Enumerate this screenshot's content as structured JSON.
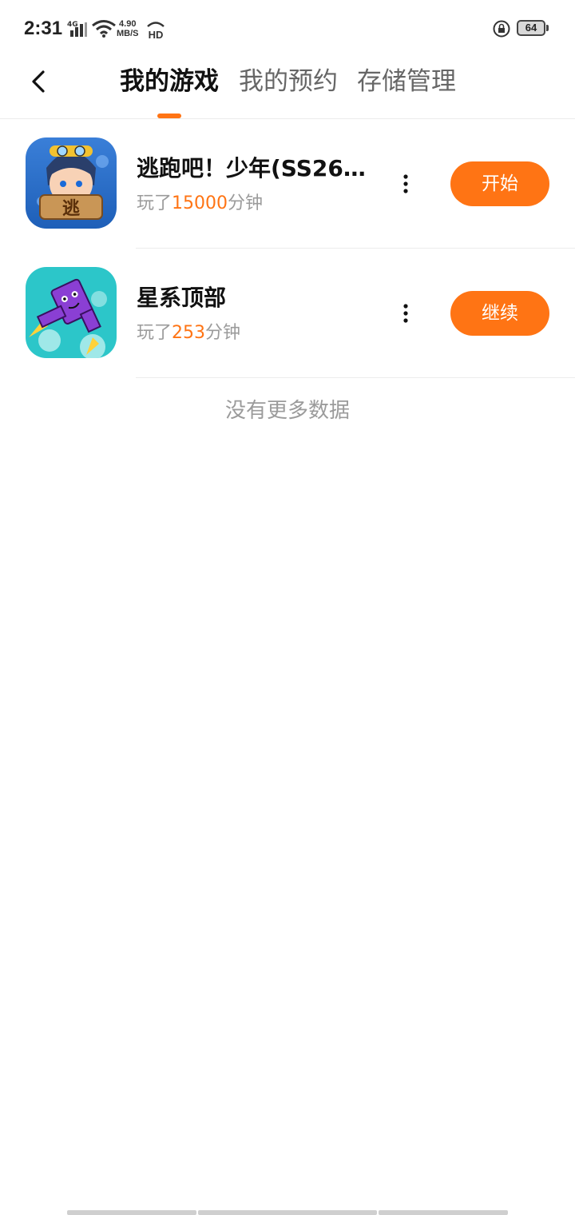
{
  "status_bar": {
    "time": "2:31",
    "network": "4G",
    "speed_value": "4.90",
    "speed_unit": "MB/S",
    "hd": "HD",
    "battery": "64"
  },
  "header": {
    "tabs": [
      {
        "label": "我的游戏",
        "active": true
      },
      {
        "label": "我的预约",
        "active": false
      },
      {
        "label": "存储管理",
        "active": false
      }
    ]
  },
  "games": [
    {
      "title": "逃跑吧！少年(SS26...",
      "played_prefix": "玩了",
      "played_minutes": "15000",
      "played_suffix": "分钟",
      "action_label": "开始",
      "icon": "escape-boy-game-icon"
    },
    {
      "title": "星系顶部",
      "played_prefix": "玩了",
      "played_minutes": "253",
      "played_suffix": "分钟",
      "action_label": "继续",
      "icon": "galaxy-top-game-icon"
    }
  ],
  "footer_text": "没有更多数据",
  "colors": {
    "accent": "#ff7414",
    "muted_text": "#9b9b9b",
    "divider": "#ececec"
  }
}
